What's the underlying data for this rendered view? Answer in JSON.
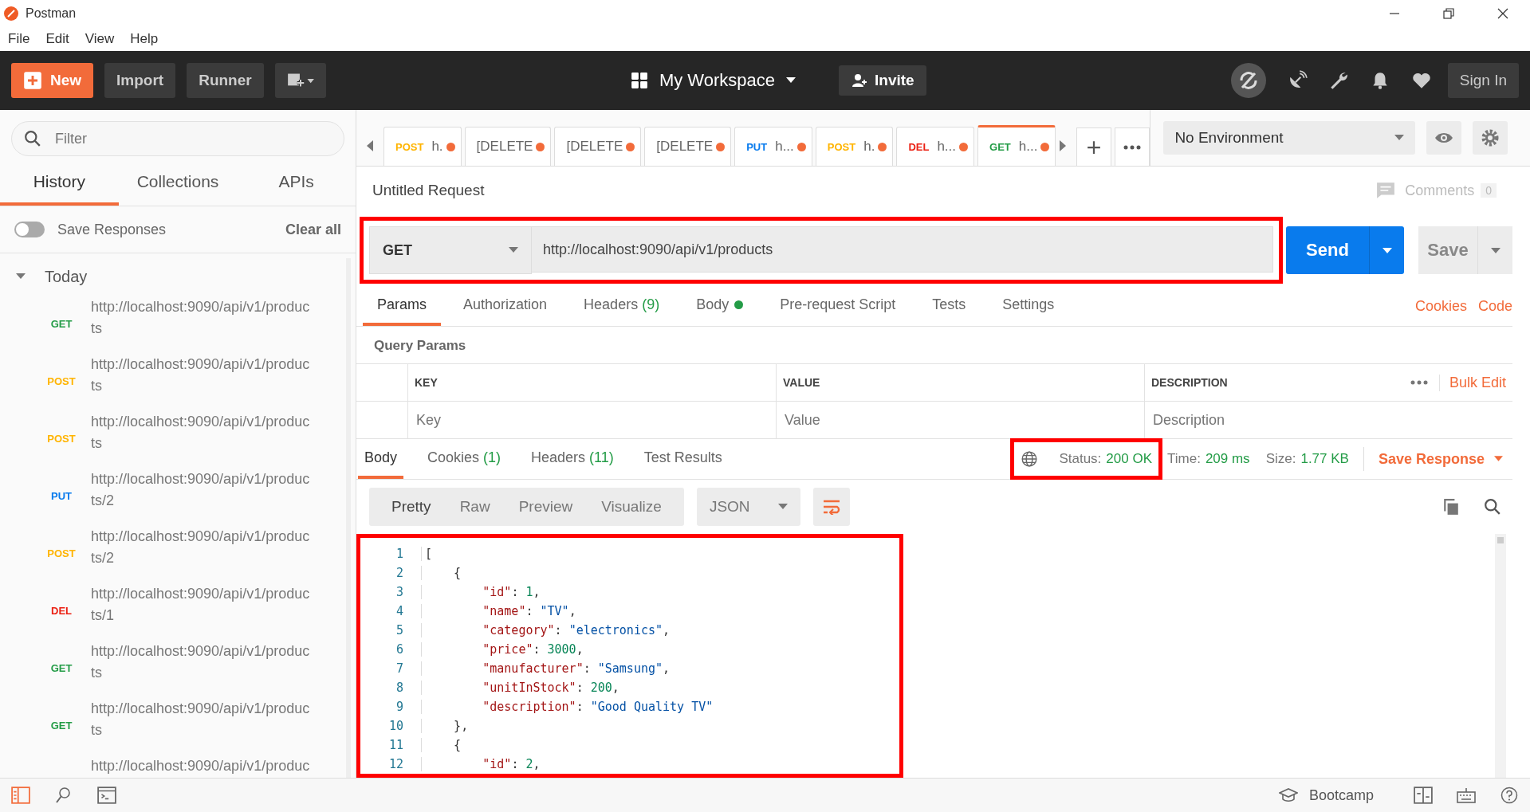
{
  "window": {
    "title": "Postman"
  },
  "menu": [
    "File",
    "Edit",
    "View",
    "Help"
  ],
  "toolbar": {
    "new_button": "New",
    "import_button": "Import",
    "runner_button": "Runner",
    "workspace": "My Workspace",
    "invite_button": "Invite",
    "sign_in_button": "Sign In"
  },
  "sidebar": {
    "filter_placeholder": "Filter",
    "tabs": [
      {
        "label": "History",
        "selected": true
      },
      {
        "label": "Collections",
        "selected": false
      },
      {
        "label": "APIs",
        "selected": false
      }
    ],
    "save_responses": {
      "label": "Save Responses",
      "on": false
    },
    "clear_all": "Clear all",
    "group": {
      "label": "Today",
      "expanded": true,
      "items": [
        {
          "method": "GET",
          "color": "#249c47",
          "url": "http://localhost:9090/api/v1/produc",
          "url_cont": "ts"
        },
        {
          "method": "POST",
          "color": "#ffb400",
          "url": "http://localhost:9090/api/v1/produc",
          "url_cont": "ts"
        },
        {
          "method": "POST",
          "color": "#ffb400",
          "url": "http://localhost:9090/api/v1/produc",
          "url_cont": "ts"
        },
        {
          "method": "PUT",
          "color": "#097bed",
          "url": "http://localhost:9090/api/v1/produc",
          "url_cont": "ts/2"
        },
        {
          "method": "POST",
          "color": "#ffb400",
          "url": "http://localhost:9090/api/v1/produc",
          "url_cont": "ts/2"
        },
        {
          "method": "DEL",
          "color": "#eb2013",
          "url": "http://localhost:9090/api/v1/produc",
          "url_cont": "ts/1"
        },
        {
          "method": "GET",
          "color": "#249c47",
          "url": "http://localhost:9090/api/v1/produc",
          "url_cont": "ts"
        },
        {
          "method": "GET",
          "color": "#249c47",
          "url": "http://localhost:9090/api/v1/produc",
          "url_cont": "ts"
        },
        {
          "url": "http://localhost:9090/api/v1/produc"
        }
      ]
    }
  },
  "request_tabs": [
    {
      "method": "POST",
      "color": "#ffb400",
      "label": "h.",
      "unsaved": true,
      "selected": false
    },
    {
      "label": "[DELETE",
      "unsaved": true,
      "selected": false
    },
    {
      "label": "[DELETE",
      "unsaved": true,
      "selected": false
    },
    {
      "label": "[DELETE",
      "unsaved": true,
      "selected": false
    },
    {
      "method": "PUT",
      "color": "#097bed",
      "label": "h...",
      "unsaved": true,
      "selected": false
    },
    {
      "method": "POST",
      "color": "#ffb400",
      "label": "h.",
      "unsaved": true,
      "selected": false
    },
    {
      "method": "DEL",
      "color": "#eb2013",
      "label": "h...",
      "unsaved": true,
      "selected": false
    },
    {
      "method": "GET",
      "color": "#249c47",
      "label": "h...",
      "unsaved": true,
      "selected": true
    }
  ],
  "environment": "No Environment",
  "request": {
    "name": "Untitled Request",
    "comments": "Comments",
    "comments_count": "0",
    "method": "GET",
    "url": "http://localhost:9090/api/v1/products",
    "highlighted": true,
    "send_button": "Send",
    "save_button": "Save",
    "tabs": [
      {
        "label": "Params",
        "dot": false,
        "selected": true
      },
      {
        "label": "Authorization",
        "dot": false,
        "selected": false
      },
      {
        "label": "Headers",
        "count": "(9)",
        "dot": false,
        "selected": false
      },
      {
        "label": "Body",
        "dot": true,
        "selected": false
      },
      {
        "label": "Pre-request Script",
        "dot": false,
        "selected": false
      },
      {
        "label": "Tests",
        "dot": false,
        "selected": false
      },
      {
        "label": "Settings",
        "dot": false,
        "selected": false
      }
    ],
    "links": [
      "Cookies",
      "Code"
    ],
    "query_params": {
      "title": "Query Params",
      "columns": [
        "KEY",
        "VALUE",
        "DESCRIPTION"
      ],
      "bulk_edit": "Bulk Edit",
      "placeholders": [
        "Key",
        "Value",
        "Description"
      ]
    }
  },
  "response": {
    "tabs": [
      {
        "label": "Body",
        "selected": true
      },
      {
        "label": "Cookies",
        "count": "(1)",
        "selected": false
      },
      {
        "label": "Headers",
        "count": "(11)",
        "selected": false
      },
      {
        "label": "Test Results",
        "selected": false
      }
    ],
    "status_label": "Status:",
    "status": "200 OK",
    "status_highlighted": true,
    "time_label": "Time:",
    "time": "209 ms",
    "size_label": "Size:",
    "size": "1.77 KB",
    "save_response": "Save Response",
    "views": [
      {
        "label": "Pretty",
        "selected": true
      },
      {
        "label": "Raw",
        "selected": false
      },
      {
        "label": "Preview",
        "selected": false
      },
      {
        "label": "Visualize",
        "selected": false
      }
    ],
    "format": "JSON",
    "body_highlighted": true,
    "lines": [
      {
        "number": "1",
        "tokens": [
          {
            "kind": "punct",
            "text": "["
          }
        ]
      },
      {
        "number": "2",
        "tokens": [
          {
            "kind": "punct",
            "text": "    {"
          }
        ]
      },
      {
        "number": "3",
        "tokens": [
          {
            "kind": "key",
            "text": "        \"id\""
          },
          {
            "kind": "punct",
            "text": ": "
          },
          {
            "kind": "number",
            "text": "1"
          },
          {
            "kind": "punct",
            "text": ","
          }
        ]
      },
      {
        "number": "4",
        "tokens": [
          {
            "kind": "key",
            "text": "        \"name\""
          },
          {
            "kind": "punct",
            "text": ": "
          },
          {
            "kind": "string",
            "text": "\"TV\""
          },
          {
            "kind": "punct",
            "text": ","
          }
        ]
      },
      {
        "number": "5",
        "tokens": [
          {
            "kind": "key",
            "text": "        \"category\""
          },
          {
            "kind": "punct",
            "text": ": "
          },
          {
            "kind": "string",
            "text": "\"electronics\""
          },
          {
            "kind": "punct",
            "text": ","
          }
        ]
      },
      {
        "number": "6",
        "tokens": [
          {
            "kind": "key",
            "text": "        \"price\""
          },
          {
            "kind": "punct",
            "text": ": "
          },
          {
            "kind": "number",
            "text": "3000"
          },
          {
            "kind": "punct",
            "text": ","
          }
        ]
      },
      {
        "number": "7",
        "tokens": [
          {
            "kind": "key",
            "text": "        \"manufacturer\""
          },
          {
            "kind": "punct",
            "text": ": "
          },
          {
            "kind": "string",
            "text": "\"Samsung\""
          },
          {
            "kind": "punct",
            "text": ","
          }
        ]
      },
      {
        "number": "8",
        "tokens": [
          {
            "kind": "key",
            "text": "        \"unitInStock\""
          },
          {
            "kind": "punct",
            "text": ": "
          },
          {
            "kind": "number",
            "text": "200"
          },
          {
            "kind": "punct",
            "text": ","
          }
        ]
      },
      {
        "number": "9",
        "tokens": [
          {
            "kind": "key",
            "text": "        \"description\""
          },
          {
            "kind": "punct",
            "text": ": "
          },
          {
            "kind": "string",
            "text": "\"Good Quality TV\""
          }
        ]
      },
      {
        "number": "10",
        "tokens": [
          {
            "kind": "punct",
            "text": "    },"
          }
        ]
      },
      {
        "number": "11",
        "tokens": [
          {
            "kind": "punct",
            "text": "    {"
          }
        ]
      },
      {
        "number": "12",
        "tokens": [
          {
            "kind": "key",
            "text": "        \"id\""
          },
          {
            "kind": "punct",
            "text": ": "
          },
          {
            "kind": "number",
            "text": "2"
          },
          {
            "kind": "punct",
            "text": ","
          }
        ]
      }
    ]
  },
  "status_bar": {
    "bootcamp": "Bootcamp"
  }
}
